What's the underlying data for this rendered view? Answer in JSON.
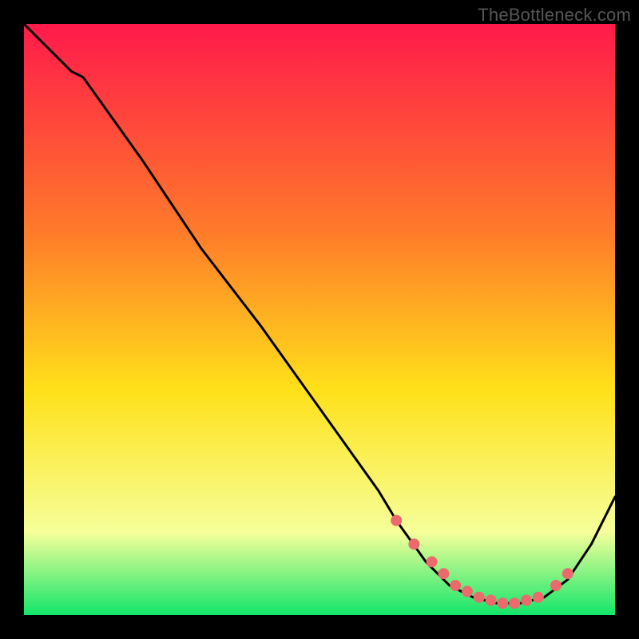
{
  "watermark": "TheBottleneck.com",
  "colors": {
    "gradient_top": "#ff1a4b",
    "gradient_mid_high": "#ff7a2a",
    "gradient_mid": "#ffe11a",
    "gradient_low": "#f6ff9a",
    "gradient_bottom": "#12e66a",
    "line": "#000000",
    "marker": "#ea6a6e",
    "frame": "#000000"
  },
  "chart_data": {
    "type": "line",
    "title": "",
    "xlabel": "",
    "ylabel": "",
    "xlim": [
      0,
      100
    ],
    "ylim": [
      0,
      100
    ],
    "series": [
      {
        "name": "curve",
        "x": [
          0,
          8,
          10,
          20,
          30,
          40,
          50,
          60,
          63,
          68,
          72,
          76,
          80,
          84,
          88,
          92,
          96,
          100
        ],
        "y": [
          100,
          92,
          91,
          77,
          62,
          49,
          35,
          21,
          16,
          9,
          5,
          3,
          2,
          2,
          3,
          6,
          12,
          20
        ]
      }
    ],
    "markers": {
      "name": "highlight-points",
      "x": [
        63,
        66,
        69,
        71,
        73,
        75,
        77,
        79,
        81,
        83,
        85,
        87,
        90,
        92
      ],
      "y": [
        16,
        12,
        9,
        7,
        5,
        4,
        3,
        2.5,
        2,
        2,
        2.5,
        3,
        5,
        7
      ]
    }
  }
}
